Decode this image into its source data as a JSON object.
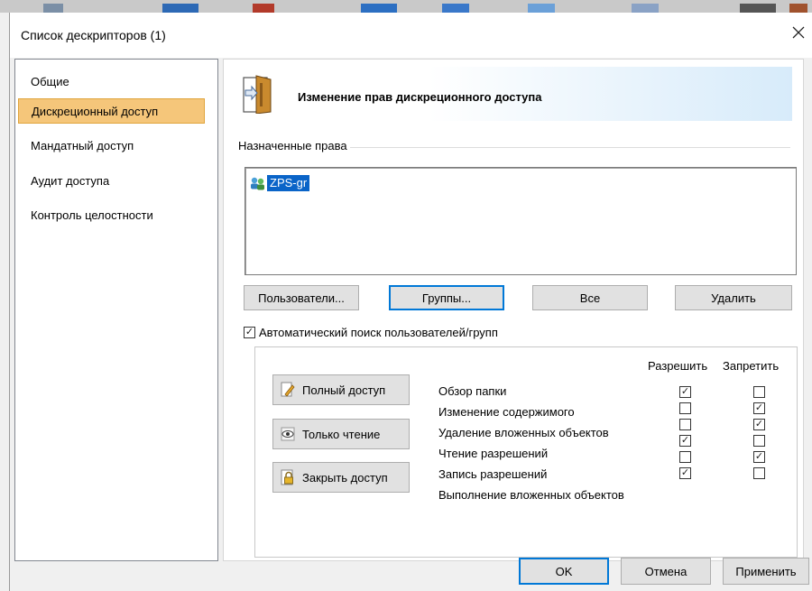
{
  "window": {
    "title": "Список дескрипторов (1)",
    "close_glyph": "✕"
  },
  "nav": {
    "items": [
      {
        "label": "Общие",
        "selected": false
      },
      {
        "label": "Дискреционный доступ",
        "selected": true
      },
      {
        "label": "Мандатный доступ",
        "selected": false
      },
      {
        "label": "Аудит доступа",
        "selected": false
      },
      {
        "label": "Контроль целостности",
        "selected": false
      }
    ]
  },
  "panel": {
    "heading": "Изменение прав дискреционного доступа",
    "icon": "door-icon",
    "assigned_group_label": "Назначенные права",
    "list": [
      {
        "name": "ZPS-gr",
        "icon": "group-icon",
        "selected": true
      }
    ],
    "buttons": {
      "users": "Пользователи...",
      "groups": "Группы...",
      "all": "Все",
      "delete": "Удалить"
    },
    "auto_search": {
      "label": "Автоматический поиск пользователей/групп",
      "checked": true
    },
    "permissions": {
      "header_allow": "Разрешить",
      "header_deny": "Запретить",
      "rows": [
        {
          "label": "Обзор папки",
          "allow": true,
          "deny": false
        },
        {
          "label": "Изменение содержимого",
          "allow": false,
          "deny": true
        },
        {
          "label": "Удаление вложенных объектов",
          "allow": false,
          "deny": true
        },
        {
          "label": "Чтение разрешений",
          "allow": true,
          "deny": false
        },
        {
          "label": "Запись разрешений",
          "allow": false,
          "deny": true
        },
        {
          "label": "Выполнение вложенных объектов",
          "allow": true,
          "deny": false
        }
      ]
    },
    "presets": [
      {
        "label": "Полный доступ",
        "icon": "edit-icon"
      },
      {
        "label": "Только чтение",
        "icon": "eye-icon"
      },
      {
        "label": "Закрыть доступ",
        "icon": "lock-icon"
      }
    ]
  },
  "footer": {
    "ok": "OK",
    "cancel": "Отмена",
    "apply": "Применить"
  },
  "colors": {
    "selection_nav": "#f5c67a",
    "list_selection": "#0a64c8",
    "focus_border": "#0078d7"
  }
}
